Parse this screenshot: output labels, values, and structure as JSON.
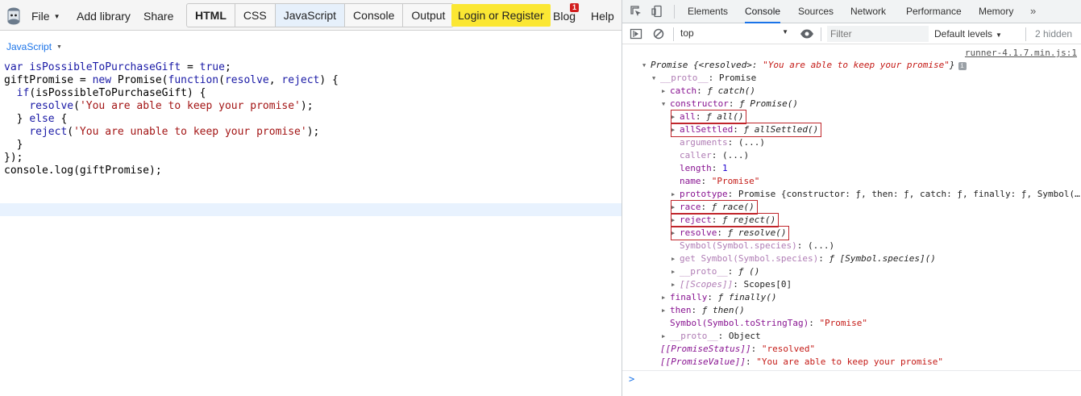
{
  "jsbin": {
    "menu": {
      "file": "File",
      "add_library": "Add library",
      "share": "Share"
    },
    "panels": [
      "HTML",
      "CSS",
      "JavaScript",
      "Console",
      "Output"
    ],
    "login": "Login or Register",
    "blog": "Blog",
    "blog_badge": "1",
    "help": "Help",
    "editor_language": "JavaScript"
  },
  "code_lines": [
    "var isPossibleToPurchaseGift = true;",
    "giftPromise = new Promise(function(resolve, reject) {",
    "  if(isPossibleToPurchaseGift) {",
    "    resolve('You are able to keep your promise');",
    "  } else {",
    "    reject('You are unable to keep your promise');",
    "  }",
    "});",
    "console.log(giftPromise);"
  ],
  "devtools": {
    "tabs": [
      "Elements",
      "Console",
      "Sources",
      "Network",
      "Performance",
      "Memory"
    ],
    "active_tab": "Console",
    "more": "»",
    "context": "top",
    "filter_placeholder": "Filter",
    "levels": "Default levels",
    "hidden": "2 hidden",
    "source": "runner-4.1.7.min.js:1",
    "colors": {
      "accent": "#1a73e8",
      "highlight_box": "#c0252b",
      "property": "#881391",
      "string": "#c41a16"
    }
  },
  "console": {
    "summary_name": "Promise",
    "summary_rest": " {<resolved>: ",
    "summary_value": "\"You are able to keep your promise\"",
    "summary_end": "}",
    "info_badge": "i",
    "proto1": "__proto__",
    "proto1_val": "Promise",
    "catch": "catch",
    "catch_val": "ƒ catch()",
    "constructor": "constructor",
    "constructor_val": "ƒ Promise()",
    "all": "all",
    "all_val": "ƒ all()",
    "allSettled": "allSettled",
    "allSettled_val": "ƒ allSettled()",
    "arguments": "arguments",
    "arguments_val": "(...)",
    "caller": "caller",
    "caller_val": "(...)",
    "length": "length",
    "length_val": "1",
    "name": "name",
    "name_val": "\"Promise\"",
    "prototype": "prototype",
    "prototype_val": "Promise {constructor: ƒ, then: ƒ, catch: ƒ, finally: ƒ, Symbol(…",
    "race": "race",
    "race_val": "ƒ race()",
    "reject": "reject",
    "reject_val": "ƒ reject()",
    "resolve": "resolve",
    "resolve_val": "ƒ resolve()",
    "species": "Symbol(Symbol.species)",
    "species_val": "(...)",
    "get_species": "get Symbol(Symbol.species)",
    "get_species_val": "ƒ [Symbol.species]()",
    "proto2": "__proto__",
    "proto2_val": "ƒ ()",
    "scopes": "[[Scopes]]",
    "scopes_val": "Scopes[0]",
    "finally": "finally",
    "finally_val": "ƒ finally()",
    "then": "then",
    "then_val": "ƒ then()",
    "tostringtag": "Symbol(Symbol.toStringTag)",
    "tostringtag_val": "\"Promise\"",
    "proto3": "__proto__",
    "proto3_val": "Object",
    "status": "[[PromiseStatus]]",
    "status_val": "\"resolved\"",
    "value": "[[PromiseValue]]",
    "value_val": "\"You are able to keep your promise\""
  },
  "prompt_symbol": ">"
}
